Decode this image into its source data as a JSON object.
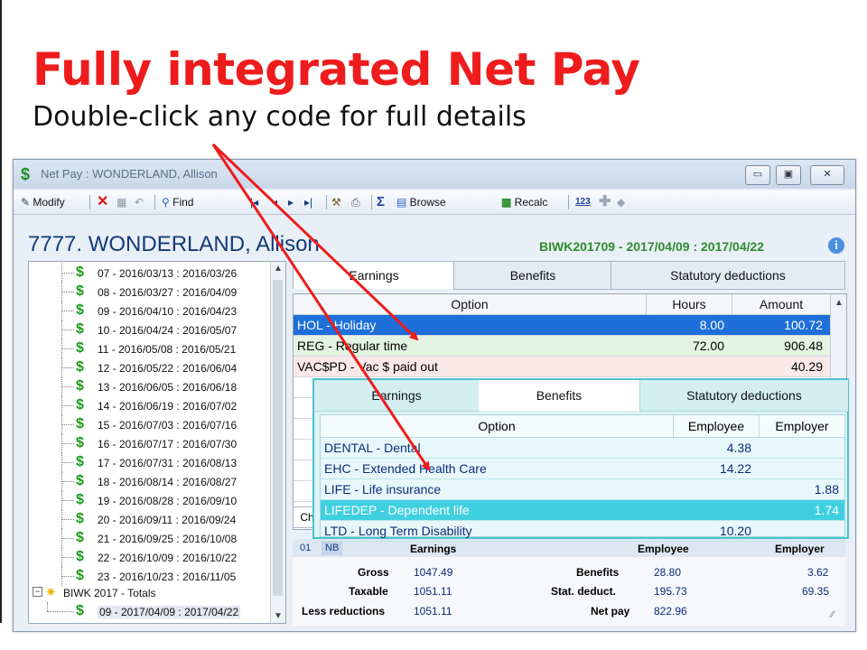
{
  "slide": {
    "headline": "Fully integrated Net Pay",
    "subheadline": "Double-click any code for full details"
  },
  "window": {
    "title": "Net Pay : WONDERLAND, Allison",
    "minimize": "▭",
    "maximize": "▣",
    "close": "✕"
  },
  "toolbar": {
    "modify": "Modify",
    "find": "Find",
    "browse": "Browse",
    "recalc": "Recalc",
    "sum_glyph": "Σ",
    "code_glyph": "123"
  },
  "employee": {
    "name": "7777. WONDERLAND, Allison",
    "period": "BIWK201709 - 2017/04/09 : 2017/04/22"
  },
  "tree": {
    "items": [
      "07 - 2016/03/13 : 2016/03/26",
      "08 - 2016/03/27 : 2016/04/09",
      "09 - 2016/04/10 : 2016/04/23",
      "10 - 2016/04/24 : 2016/05/07",
      "11 - 2016/05/08 : 2016/05/21",
      "12 - 2016/05/22 : 2016/06/04",
      "13 - 2016/06/05 : 2016/06/18",
      "14 - 2016/06/19 : 2016/07/02",
      "15 - 2016/07/03 : 2016/07/16",
      "16 - 2016/07/17 : 2016/07/30",
      "17 - 2016/07/31 : 2016/08/13",
      "18 - 2016/08/14 : 2016/08/27",
      "19 - 2016/08/28 : 2016/09/10",
      "20 - 2016/09/11 : 2016/09/24",
      "21 - 2016/09/25 : 2016/10/08",
      "22 - 2016/10/09 : 2016/10/22",
      "23 - 2016/10/23 : 2016/11/05"
    ],
    "totals_group": "BIWK 2017 - Totals",
    "totals_item": "09 - 2017/04/09 : 2017/04/22"
  },
  "tabs": [
    "Earnings",
    "Benefits",
    "Statutory deductions"
  ],
  "earnings_grid": {
    "columns": [
      "Option",
      "Hours",
      "Amount"
    ],
    "rows": [
      {
        "option": "HOL - Holiday",
        "hours": "8.00",
        "amount": "100.72"
      },
      {
        "option": "REG - Regular time",
        "hours": "72.00",
        "amount": "906.48"
      },
      {
        "option": "VAC$PD - Vac $ paid out",
        "hours": "",
        "amount": "40.29"
      }
    ]
  },
  "ch_tab": "Ch",
  "summary": {
    "code1": "01",
    "code2": "NB",
    "earnings_hdr": "Earnings",
    "employee_hdr": "Employee",
    "employer_hdr": "Employer",
    "gross_label": "Gross",
    "gross": "1047.49",
    "taxable_label": "Taxable",
    "taxable": "1051.11",
    "less_label": "Less reductions",
    "less": "1051.11",
    "benefits_label": "Benefits",
    "benefits_emp": "28.80",
    "benefits_er": "3.62",
    "stat_label": "Stat. deduct.",
    "stat_emp": "195.73",
    "stat_er": "69.35",
    "net_label": "Net pay",
    "net": "822.96"
  },
  "benefits_overlay": {
    "tabs": [
      "Earnings",
      "Benefits",
      "Statutory deductions"
    ],
    "columns": [
      "Option",
      "Employee",
      "Employer"
    ],
    "rows": [
      {
        "option": "DENTAL - Dental",
        "employee": "4.38",
        "employer": ""
      },
      {
        "option": "EHC - Extended Health Care",
        "employee": "14.22",
        "employer": ""
      },
      {
        "option": "LIFE - Life insurance",
        "employee": "",
        "employer": "1.88"
      },
      {
        "option": "LIFEDEP - Dependent life",
        "employee": "",
        "employer": "1.74"
      },
      {
        "option": "LTD - Long Term Disability",
        "employee": "10.20",
        "employer": ""
      }
    ]
  },
  "colors": {
    "headline": "#ee1c1c",
    "selected_row": "#1e6fd9",
    "overlay_selected": "#3fd0e0",
    "arrow": "#ee1c1c"
  }
}
